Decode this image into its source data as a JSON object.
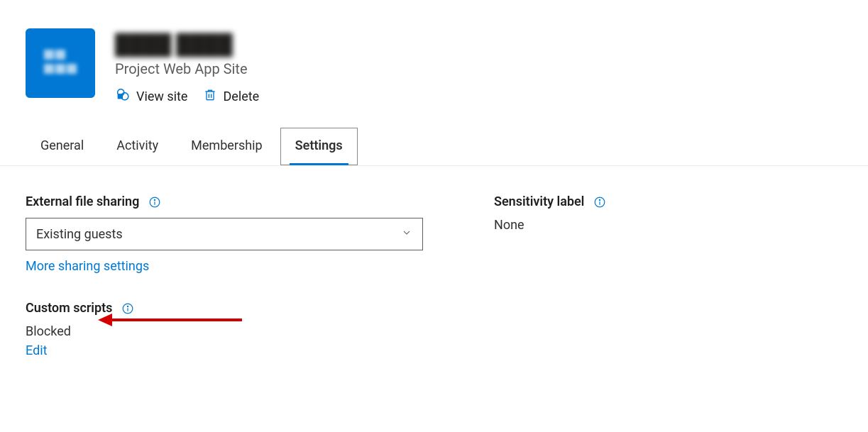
{
  "header": {
    "title": "████ ████",
    "subtitle": "Project Web App Site",
    "view_site_label": "View site",
    "delete_label": "Delete"
  },
  "tabs": {
    "general": "General",
    "activity": "Activity",
    "membership": "Membership",
    "settings": "Settings"
  },
  "external_sharing": {
    "heading": "External file sharing",
    "selected": "Existing guests",
    "more_link": "More sharing settings"
  },
  "custom_scripts": {
    "heading": "Custom scripts",
    "status": "Blocked",
    "edit_link": "Edit"
  },
  "sensitivity": {
    "heading": "Sensitivity label",
    "value": "None"
  }
}
